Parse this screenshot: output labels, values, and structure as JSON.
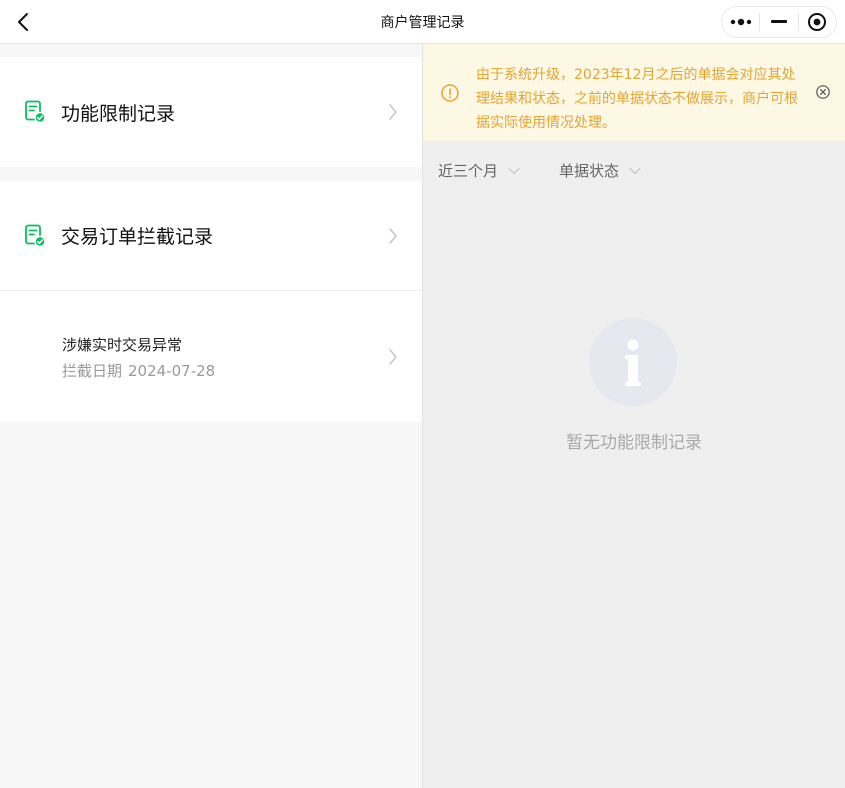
{
  "nav": {
    "title": "商户管理记录",
    "back_icon": "chevron-left-icon",
    "capsule_icons": [
      "more-dots-icon",
      "minimize-icon",
      "close-circle-icon"
    ]
  },
  "left": {
    "card1": {
      "label": "功能限制记录",
      "icon": "document-check-icon"
    },
    "card2": {
      "label": "交易订单拦截记录",
      "icon": "document-check-icon",
      "record": {
        "title": "涉嫌实时交易异常",
        "date_label": "拦截日期",
        "date_value": "2024-07-28"
      }
    }
  },
  "right": {
    "notice": {
      "text": "由于系统升级，2023年12月之后的单据会对应其处理结果和状态，之前的单据状态不做展示，商户可根据实际使用情况处理。",
      "icon": "info-circle-icon",
      "close_icon": "close-circle-icon"
    },
    "filters": [
      {
        "label": "近三个月"
      },
      {
        "label": "单据状态"
      }
    ],
    "empty": {
      "text": "暂无功能限制记录",
      "icon": "info-icon"
    }
  },
  "colors": {
    "accent_green": "#07c160",
    "notice_text": "#e3a534",
    "notice_bg": "#fdf8e4"
  }
}
